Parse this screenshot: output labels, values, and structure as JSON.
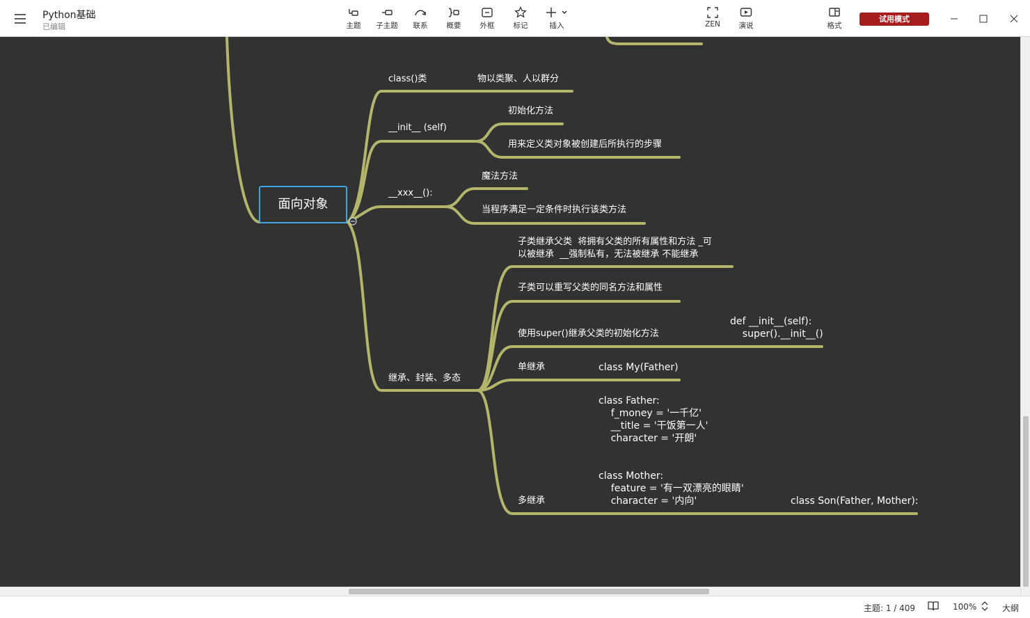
{
  "header": {
    "doc_title": "Python基础",
    "doc_status": "已编辑",
    "trial_label": "试用模式"
  },
  "toolbar": {
    "topic": "主题",
    "subtopic": "子主题",
    "relation": "联系",
    "summary": "概要",
    "boundary": "外框",
    "marker": "标记",
    "insert": "插入",
    "zen": "ZEN",
    "present": "演说",
    "format": "格式"
  },
  "map": {
    "central": "面向对象",
    "class_node": "class()类",
    "class_note": "物以类聚、人以群分",
    "init_node": "__init__ (self)",
    "init_sub1": "初始化方法",
    "init_sub2": "用来定义类对象被创建后所执行的步骤",
    "magic_node": "__xxx__():",
    "magic_sub1": "魔法方法",
    "magic_sub2": "当程序满足一定条件时执行该类方法",
    "inherit_node": "继承、封装、多态",
    "inh_sub1": "子类继承父类  将拥有父类的所有属性和方法 _可\n以被继承  __强制私有，无法被继承 不能继承",
    "inh_sub2": "子类可以重写父类的同名方法和属性",
    "inh_sub3": "使用super()继承父类的初始化方法",
    "inh_sub3_note": "def __init__(self):\n    super().__init__()",
    "inh_sub4": "单继承",
    "inh_sub4_note": "class My(Father)",
    "inh_sub5": "多继承",
    "inh_sub5_note": "class Father:\n    f_money = '一千亿'\n    __title = '干饭第一人'\n    character = '开朗'\n\n\nclass Mother:\n    feature = '有一双漂亮的眼睛'\n    character = '内向'",
    "inh_sub5_note2": "class Son(Father, Mother):"
  },
  "status": {
    "topic_count": "主题: 1 / 409",
    "zoom": "100%",
    "outline": "大纲"
  },
  "colors": {
    "canvas": "#323232",
    "branch": "#b3b56a",
    "central_border": "#3aa7e0",
    "trial": "#a71d1d"
  }
}
